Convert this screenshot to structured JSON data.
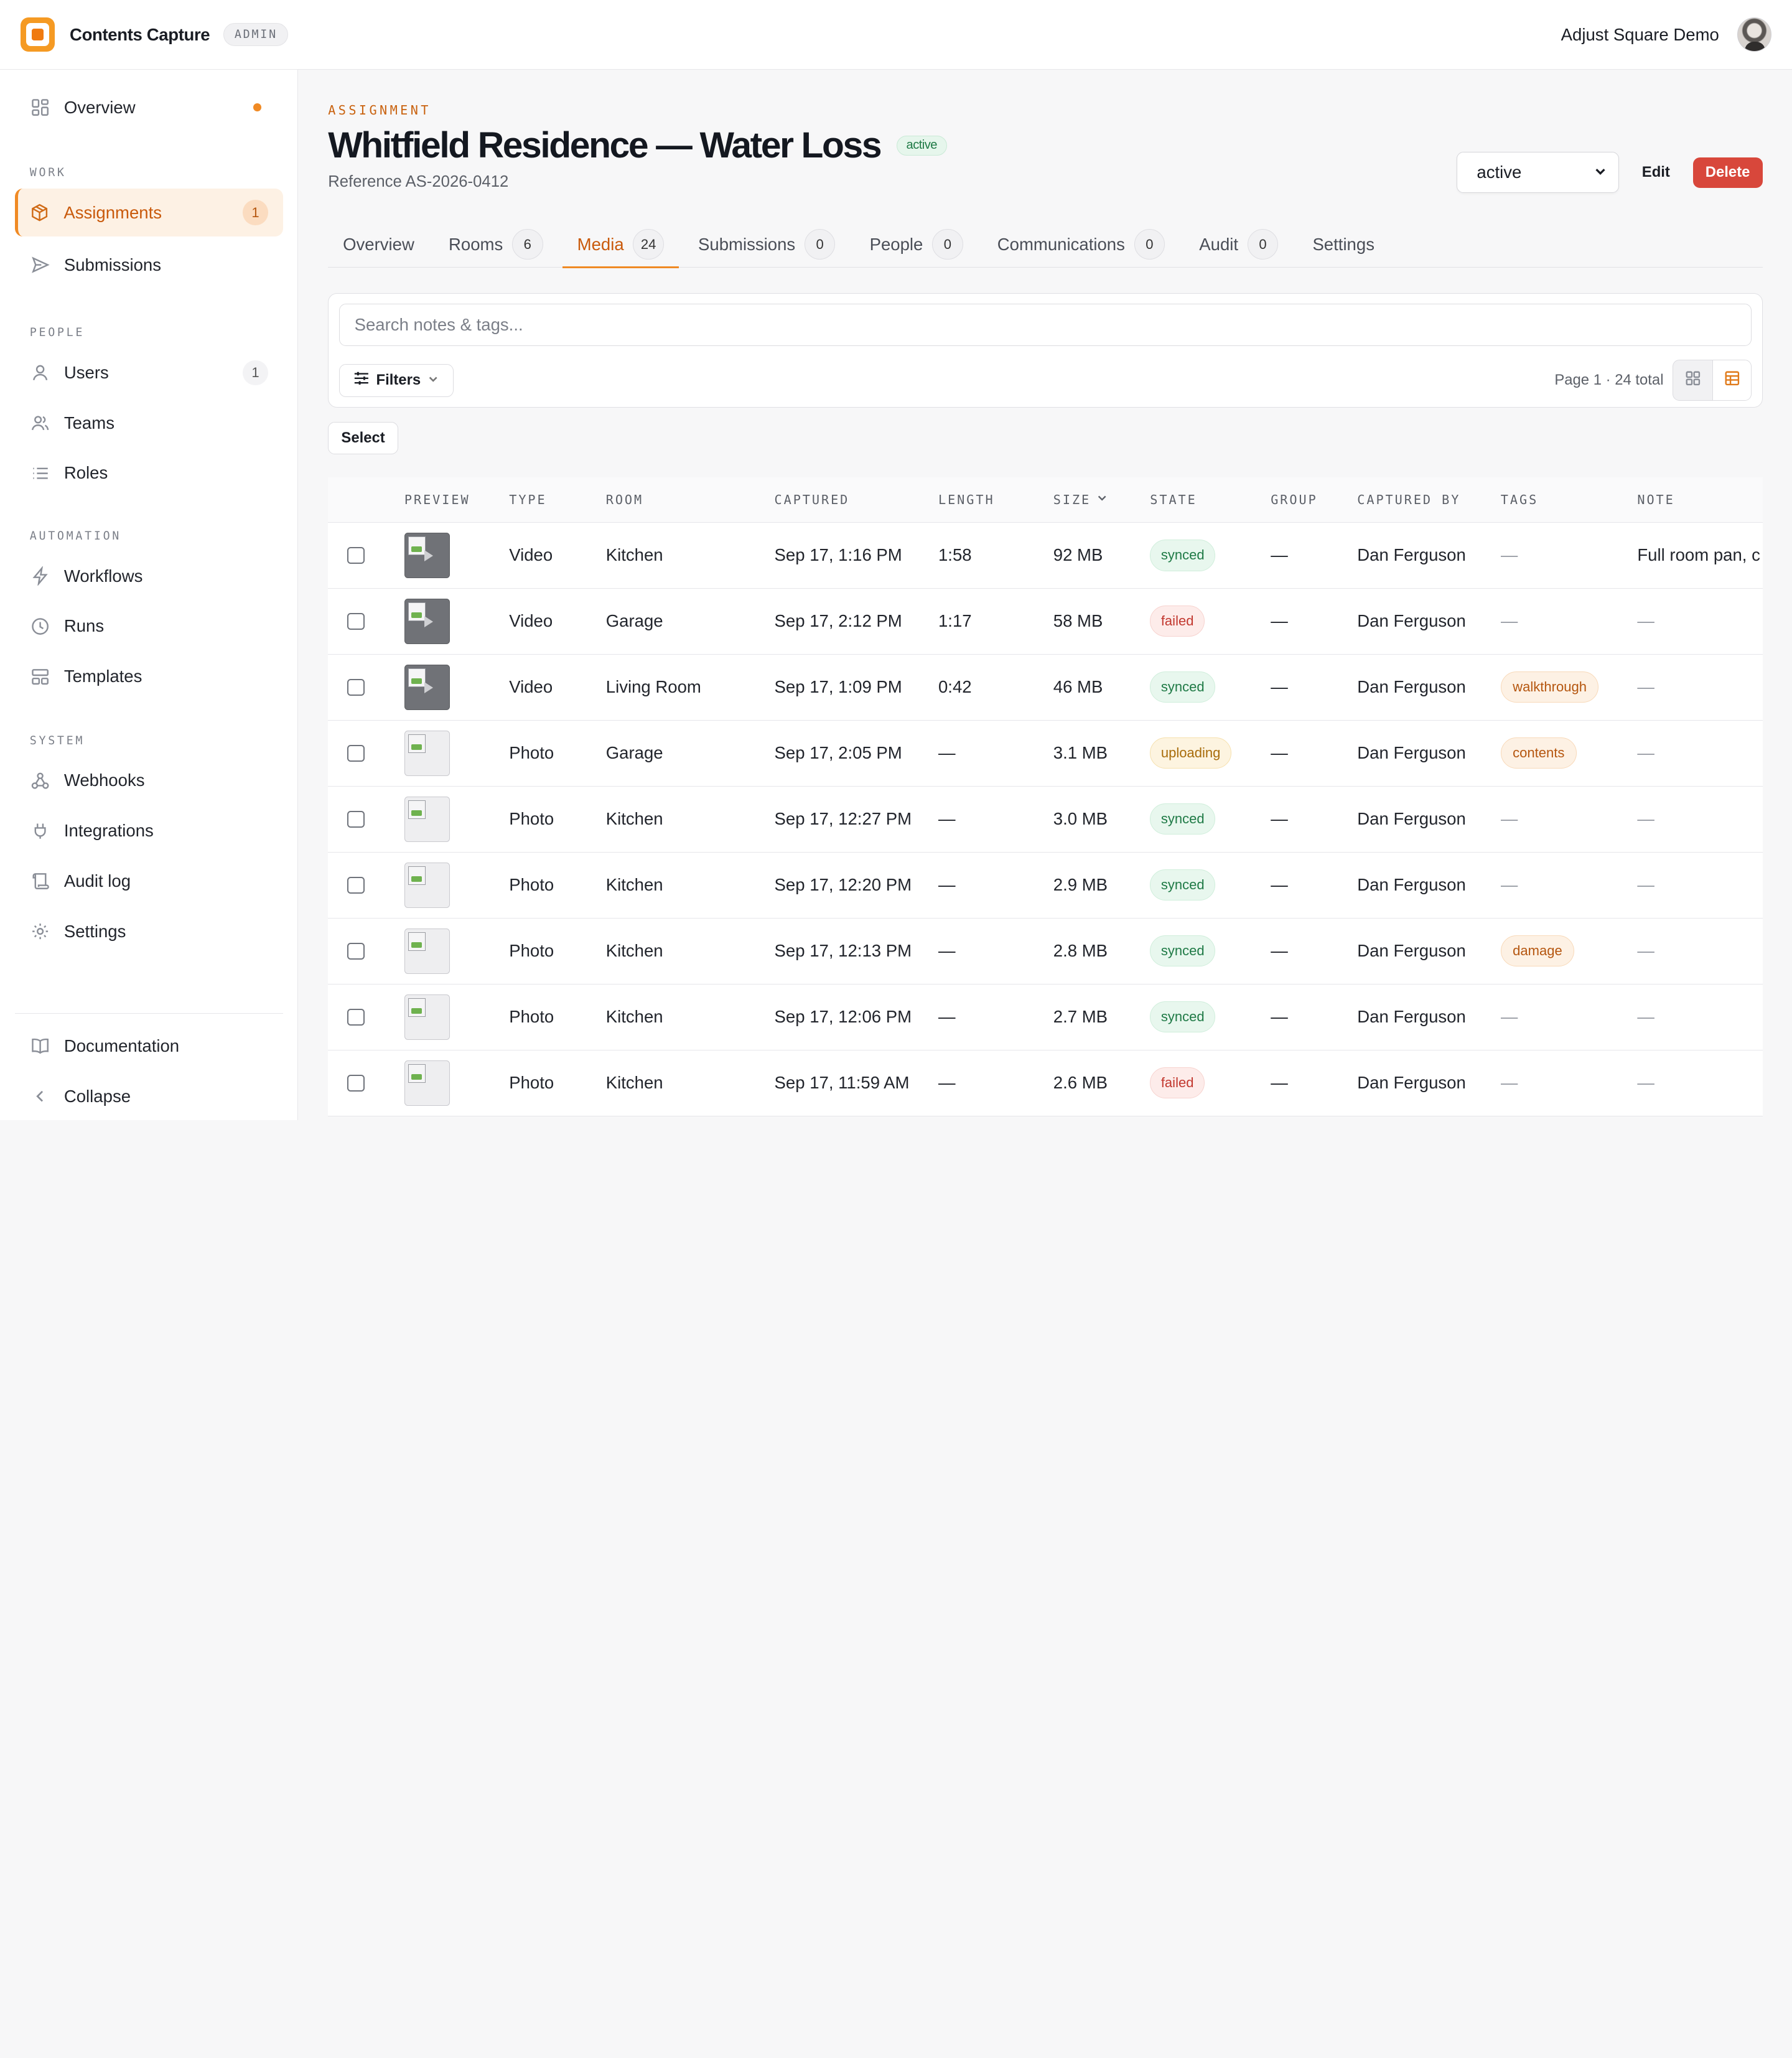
{
  "app": {
    "name": "Contents Capture",
    "badge": "ADMIN",
    "org": "Adjust Square Demo",
    "accent": "#f08a24"
  },
  "sidebar": {
    "overview": "Overview",
    "sections": {
      "work": "WORK",
      "people": "PEOPLE",
      "automation": "AUTOMATION",
      "system": "SYSTEM"
    },
    "items": {
      "assignments": {
        "label": "Assignments",
        "count": "1"
      },
      "submissions": {
        "label": "Submissions"
      },
      "users": {
        "label": "Users",
        "count": "1"
      },
      "teams": {
        "label": "Teams"
      },
      "roles": {
        "label": "Roles"
      },
      "workflows": {
        "label": "Workflows"
      },
      "runs": {
        "label": "Runs"
      },
      "templates": {
        "label": "Templates"
      },
      "webhooks": {
        "label": "Webhooks"
      },
      "integrations": {
        "label": "Integrations"
      },
      "audit_log": {
        "label": "Audit log"
      },
      "settings": {
        "label": "Settings"
      }
    },
    "footer": {
      "documentation": "Documentation",
      "collapse": "Collapse"
    }
  },
  "header": {
    "eyebrow": "ASSIGNMENT",
    "title": "Whitfield Residence — Water Loss",
    "status": "active",
    "reference": "Reference AS-2026-0412",
    "state_select": "active",
    "edit": "Edit",
    "delete": "Delete"
  },
  "tabs": [
    {
      "label": "Overview"
    },
    {
      "label": "Rooms",
      "count": "6"
    },
    {
      "label": "Media",
      "count": "24"
    },
    {
      "label": "Submissions",
      "count": "0"
    },
    {
      "label": "People",
      "count": "0"
    },
    {
      "label": "Communications",
      "count": "0"
    },
    {
      "label": "Audit",
      "count": "0"
    },
    {
      "label": "Settings"
    }
  ],
  "toolbar": {
    "search_placeholder": "Search notes & tags...",
    "filters": "Filters",
    "page_info": "Page 1 · 24 total",
    "select": "Select"
  },
  "table": {
    "columns": {
      "preview": "PREVIEW",
      "type": "TYPE",
      "room": "ROOM",
      "captured": "CAPTURED",
      "length": "LENGTH",
      "size": "SIZE",
      "state": "STATE",
      "group": "GROUP",
      "captured_by": "CAPTURED BY",
      "tags": "TAGS",
      "note": "NOTE"
    },
    "rows": [
      {
        "type": "Video",
        "room": "Kitchen",
        "captured": "Sep 17, 1:16 PM",
        "length": "1:58",
        "size": "92 MB",
        "state": "synced",
        "group": "—",
        "by": "Dan Ferguson",
        "tag": "",
        "note": "Full room pan, c"
      },
      {
        "type": "Video",
        "room": "Garage",
        "captured": "Sep 17, 2:12 PM",
        "length": "1:17",
        "size": "58 MB",
        "state": "failed",
        "group": "—",
        "by": "Dan Ferguson",
        "tag": "",
        "note": "—"
      },
      {
        "type": "Video",
        "room": "Living Room",
        "captured": "Sep 17, 1:09 PM",
        "length": "0:42",
        "size": "46 MB",
        "state": "synced",
        "group": "—",
        "by": "Dan Ferguson",
        "tag": "walkthrough",
        "note": "—"
      },
      {
        "type": "Photo",
        "room": "Garage",
        "captured": "Sep 17, 2:05 PM",
        "length": "—",
        "size": "3.1 MB",
        "state": "uploading",
        "group": "—",
        "by": "Dan Ferguson",
        "tag": "contents",
        "note": "—"
      },
      {
        "type": "Photo",
        "room": "Kitchen",
        "captured": "Sep 17, 12:27 PM",
        "length": "—",
        "size": "3.0 MB",
        "state": "synced",
        "group": "—",
        "by": "Dan Ferguson",
        "tag": "",
        "note": "—"
      },
      {
        "type": "Photo",
        "room": "Kitchen",
        "captured": "Sep 17, 12:20 PM",
        "length": "—",
        "size": "2.9 MB",
        "state": "synced",
        "group": "—",
        "by": "Dan Ferguson",
        "tag": "",
        "note": "—"
      },
      {
        "type": "Photo",
        "room": "Kitchen",
        "captured": "Sep 17, 12:13 PM",
        "length": "—",
        "size": "2.8 MB",
        "state": "synced",
        "group": "—",
        "by": "Dan Ferguson",
        "tag": "damage",
        "note": "—"
      },
      {
        "type": "Photo",
        "room": "Kitchen",
        "captured": "Sep 17, 12:06 PM",
        "length": "—",
        "size": "2.7 MB",
        "state": "synced",
        "group": "—",
        "by": "Dan Ferguson",
        "tag": "",
        "note": "—"
      },
      {
        "type": "Photo",
        "room": "Kitchen",
        "captured": "Sep 17, 11:59 AM",
        "length": "—",
        "size": "2.6 MB",
        "state": "failed",
        "group": "—",
        "by": "Dan Ferguson",
        "tag": "",
        "note": "—"
      }
    ],
    "empty_tag": "—"
  }
}
